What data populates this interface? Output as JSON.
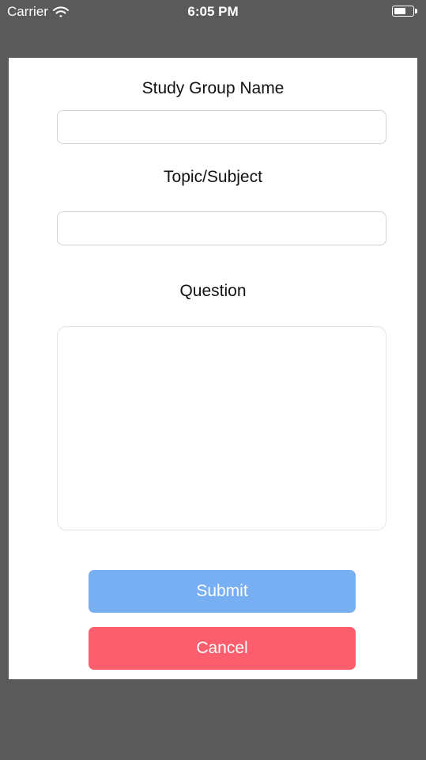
{
  "status_bar": {
    "carrier": "Carrier",
    "time": "6:05 PM",
    "icons": [
      "wifi-icon",
      "battery-icon"
    ]
  },
  "form": {
    "group_name_label": "Study Group Name",
    "group_name_value": "",
    "topic_label": "Topic/Subject",
    "topic_value": "",
    "question_label": "Question",
    "question_value": ""
  },
  "buttons": {
    "submit_label": "Submit",
    "cancel_label": "Cancel"
  },
  "colors": {
    "overlay": "#5a5a5a",
    "panel": "#ffffff",
    "submit": "#78aef2",
    "cancel": "#fd5e6e"
  }
}
